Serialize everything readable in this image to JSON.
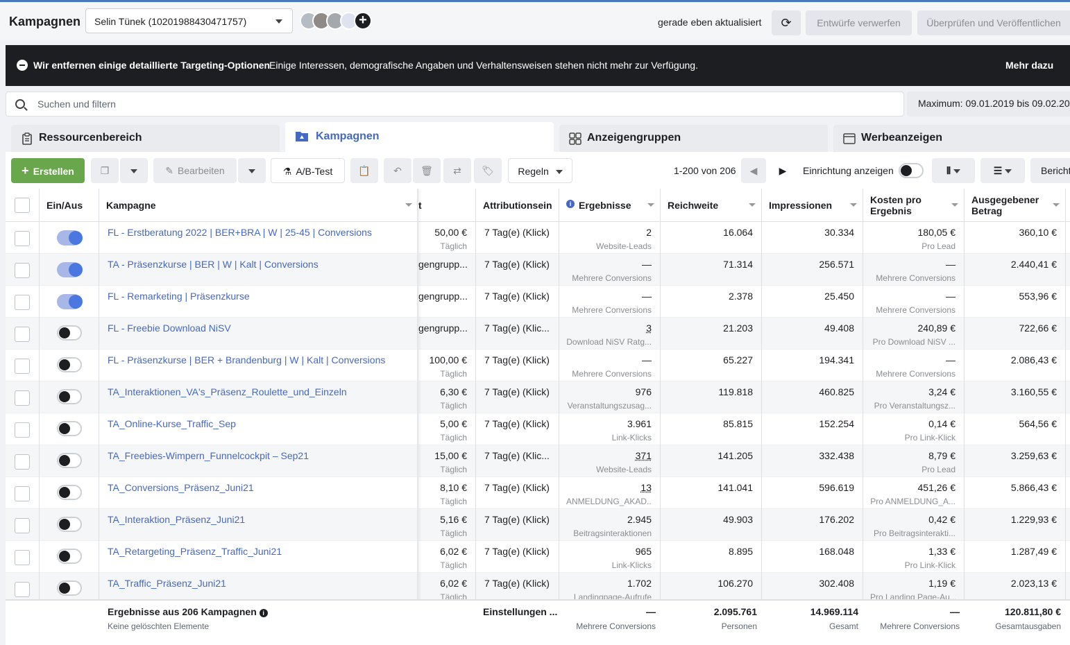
{
  "app": {
    "title": "Kampagnen"
  },
  "account": {
    "selected": "Selin Tünek (10201988430471757)"
  },
  "header": {
    "updated": "gerade eben aktualisiert",
    "discard": "Entwürfe verwerfen",
    "publish": "Überprüfen und Veröffentlichen"
  },
  "banner": {
    "title": "Wir entfernen einige detaillierte Targeting-Optionen",
    "text": "Einige Interessen, demografische Angaben und Verhaltensweisen stehen nicht mehr zur Verfügung.",
    "link": "Mehr dazu"
  },
  "search": {
    "placeholder": "Suchen und filtern"
  },
  "daterange": "Maximum: 09.01.2019 bis 09.02.20",
  "tabs": [
    {
      "label": "Ressourcenbereich"
    },
    {
      "label": "Kampagnen"
    },
    {
      "label": "Anzeigengruppen"
    },
    {
      "label": "Werbeanzeigen"
    }
  ],
  "toolbar": {
    "create": "Erstellen",
    "edit": "Bearbeiten",
    "abtest": "A/B-Test",
    "rules": "Regeln",
    "pager": "1-200 von 206",
    "setup": "Einrichtung anzeigen",
    "report": "Bericht"
  },
  "columns": {
    "onoff": "Ein/Aus",
    "campaign": "Kampagne",
    "budget": "t",
    "attribution": "Attributionsein",
    "results": "Ergebnisse",
    "reach": "Reichweite",
    "impressions": "Impressionen",
    "cpr1": "Kosten pro",
    "cpr2": "Ergebnis",
    "spent1": "Ausgegebener",
    "spent2": "Betrag"
  },
  "rows": [
    {
      "name": "FL - Erstberatung 2022 | BER+BRA | W | 25-45 | Conversions",
      "on": true,
      "budget": "50,00 €",
      "budget_sub": "Täglich",
      "attr": "7 Tag(e) (Klick)",
      "res": "2",
      "res_sub": "Website-Leads",
      "reach": "16.064",
      "impr": "30.334",
      "cpr": "180,05 €",
      "cpr_sub": "Pro Lead",
      "spent": "360,10 €"
    },
    {
      "name": "TA - Präsenzkurse | BER | W | Kalt | Conversions",
      "on": true,
      "budget": "gengrupp...",
      "budget_sub": "",
      "attr": "7 Tag(e) (Klick)",
      "res": "—",
      "res_sub": "Mehrere Conversions",
      "reach": "71.314",
      "impr": "256.571",
      "cpr": "—",
      "cpr_sub": "Mehrere Conversions",
      "spent": "2.440,41 €"
    },
    {
      "name": "FL - Remarketing | Präsenzkurse",
      "on": true,
      "budget": "gengrupp...",
      "budget_sub": "",
      "attr": "7 Tag(e) (Klick)",
      "res": "—",
      "res_sub": "Mehrere Conversions",
      "reach": "2.378",
      "impr": "25.450",
      "cpr": "—",
      "cpr_sub": "Mehrere Conversions",
      "spent": "553,96 €"
    },
    {
      "name": "FL - Freebie Download NiSV",
      "on": false,
      "budget": "gengrupp...",
      "budget_sub": "",
      "attr": "7 Tag(e) (Klic...",
      "res": "3",
      "res_sub": "Download NiSV Ratg...",
      "reach": "21.203",
      "impr": "49.408",
      "cpr": "240,89 €",
      "cpr_sub": "Pro Download NiSV ...",
      "spent": "722,66 €"
    },
    {
      "name": "FL - Präsenzkurse | BER + Brandenburg | W | Kalt | Conversions",
      "on": false,
      "budget": "100,00 €",
      "budget_sub": "Täglich",
      "attr": "7 Tag(e) (Klick)",
      "res": "—",
      "res_sub": "Mehrere Conversions",
      "reach": "65.227",
      "impr": "194.341",
      "cpr": "—",
      "cpr_sub": "Mehrere Conversions",
      "spent": "2.086,43 €"
    },
    {
      "name": "TA_Interaktionen_VA's_Präsenz_Roulette_und_Einzeln",
      "on": false,
      "budget": "6,30 €",
      "budget_sub": "Täglich",
      "attr": "7 Tag(e) (Klick)",
      "res": "976",
      "res_sub": "Veranstaltungszusag...",
      "reach": "119.818",
      "impr": "460.825",
      "cpr": "3,24 €",
      "cpr_sub": "Pro Veranstaltungsz...",
      "spent": "3.160,55 €"
    },
    {
      "name": "TA_Online-Kurse_Traffic_Sep",
      "on": false,
      "budget": "5,00 €",
      "budget_sub": "Täglich",
      "attr": "7 Tag(e) (Klick)",
      "res": "3.961",
      "res_sub": "Link-Klicks",
      "reach": "85.815",
      "impr": "152.254",
      "cpr": "0,14 €",
      "cpr_sub": "Pro Link-Klick",
      "spent": "564,56 €"
    },
    {
      "name": "TA_Freebies-Wimpern_Funnelcockpit – Sep21",
      "on": false,
      "budget": "15,00 €",
      "budget_sub": "Täglich",
      "attr": "7 Tag(e) (Klic...",
      "res": "371",
      "res_sub": "Website-Leads",
      "reach": "141.205",
      "impr": "332.438",
      "cpr": "8,79 €",
      "cpr_sub": "Pro Lead",
      "spent": "3.259,63 €"
    },
    {
      "name": "TA_Conversions_Präsenz_Juni21",
      "on": false,
      "budget": "8,10 €",
      "budget_sub": "Täglich",
      "attr": "7 Tag(e) (Klick)",
      "res": "13",
      "res_sub": "ANMELDUNG_AKAD...",
      "reach": "141.041",
      "impr": "596.619",
      "cpr": "451,26 €",
      "cpr_sub": "Pro ANMELDUNG_A...",
      "spent": "5.866,43 €"
    },
    {
      "name": "TA_Interaktion_Präsenz_Juni21",
      "on": false,
      "budget": "5,16 €",
      "budget_sub": "Täglich",
      "attr": "7 Tag(e) (Klick)",
      "res": "2.945",
      "res_sub": "Beitragsinteraktionen",
      "reach": "49.903",
      "impr": "176.202",
      "cpr": "0,42 €",
      "cpr_sub": "Pro Beitragsinterakti...",
      "spent": "1.229,93 €"
    },
    {
      "name": "TA_Retargeting_Präsenz_Traffic_Juni21",
      "on": false,
      "budget": "6,02 €",
      "budget_sub": "Täglich",
      "attr": "7 Tag(e) (Klick)",
      "res": "965",
      "res_sub": "Link-Klicks",
      "reach": "8.895",
      "impr": "168.048",
      "cpr": "1,33 €",
      "cpr_sub": "Pro Link-Klick",
      "spent": "1.287,49 €"
    },
    {
      "name": "TA_Traffic_Präsenz_Juni21",
      "on": false,
      "budget": "6,02 €",
      "budget_sub": "Täglich",
      "attr": "7 Tag(e) (Klick)",
      "res": "1.702",
      "res_sub": "Landingpage-Aufrufe",
      "reach": "106.270",
      "impr": "302.408",
      "cpr": "1,19 €",
      "cpr_sub": "Pro Landing Page-Au...",
      "spent": "2.023,13 €"
    }
  ],
  "footer": {
    "title": "Ergebnisse aus 206 Kampagnen",
    "subtitle": "Keine gelöschten Elemente",
    "attr": "Einstellungen ...",
    "res": "—",
    "res_sub": "Mehrere Conversions",
    "reach": "2.095.761",
    "reach_sub": "Personen",
    "impr": "14.969.114",
    "impr_sub": "Gesamt",
    "cpr": "—",
    "cpr_sub": "Mehrere Conversions",
    "spent": "120.811,80 €",
    "spent_sub": "Gesamtausgaben"
  },
  "colors": {
    "accent": "#4468c4",
    "create": "#69a74c",
    "banner": "#1c1e21"
  }
}
